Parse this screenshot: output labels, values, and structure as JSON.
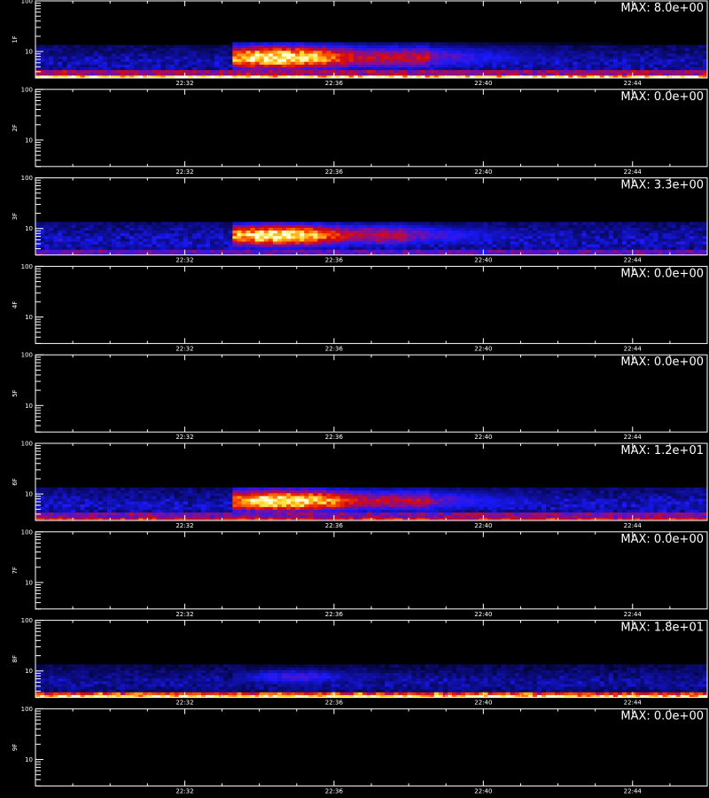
{
  "chart_data": [
    {
      "type": "heatmap",
      "ylabel": "1F",
      "max_label": "MAX: 8.0e+00",
      "max": 8.0,
      "yscale": "log",
      "ylim": [
        3,
        100
      ],
      "yticklabels": [
        "100",
        "10"
      ],
      "xticklabels": [
        "22:32",
        "22:36",
        "22:40",
        "22:44"
      ],
      "xlim": [
        "22:28",
        "22:46"
      ],
      "signal": {
        "start": "22:33:20",
        "peak": "22:34:30",
        "end": "22:38:30",
        "emin": 5,
        "emax": 12,
        "tail_end": "22:46",
        "floor_band": {
          "emin": 3,
          "emax": 3.6,
          "level": 0.95
        },
        "blue_band": {
          "emin": 3.6,
          "emax": 4.4,
          "level": 0.5
        },
        "background": 0.1
      }
    },
    {
      "type": "heatmap",
      "ylabel": "2F",
      "max_label": "MAX: 0.0e+00",
      "max": 0.0,
      "yscale": "log",
      "ylim": [
        3,
        100
      ],
      "yticklabels": [
        "100",
        "10"
      ],
      "xticklabels": [
        "22:32",
        "22:36",
        "22:40",
        "22:44"
      ],
      "xlim": [
        "22:28",
        "22:46"
      ],
      "signal": null
    },
    {
      "type": "heatmap",
      "ylabel": "3F",
      "max_label": "MAX: 3.3e+00",
      "max": 3.3,
      "yscale": "log",
      "ylim": [
        3,
        100
      ],
      "yticklabels": [
        "100",
        "10"
      ],
      "xticklabels": [
        "22:32",
        "22:36",
        "22:40",
        "22:44"
      ],
      "xlim": [
        "22:28",
        "22:46"
      ],
      "signal": {
        "start": "22:33:20",
        "peak": "22:34:30",
        "end": "22:38:00",
        "emin": 5,
        "emax": 11,
        "tail_end": "22:46",
        "floor_band": null,
        "blue_band": {
          "emin": 3,
          "emax": 3.8,
          "level": 0.4
        },
        "background": 0.12
      }
    },
    {
      "type": "heatmap",
      "ylabel": "4F",
      "max_label": "MAX: 0.0e+00",
      "max": 0.0,
      "yscale": "log",
      "ylim": [
        3,
        100
      ],
      "yticklabels": [
        "100",
        "10"
      ],
      "xticklabels": [
        "22:32",
        "22:36",
        "22:40",
        "22:44"
      ],
      "xlim": [
        "22:28",
        "22:46"
      ],
      "signal": null
    },
    {
      "type": "heatmap",
      "ylabel": "5F",
      "max_label": "MAX: 0.0e+00",
      "max": 0.0,
      "yscale": "log",
      "ylim": [
        3,
        100
      ],
      "yticklabels": [
        "100",
        "10"
      ],
      "xticklabels": [
        "22:32",
        "22:36",
        "22:40",
        "22:44"
      ],
      "xlim": [
        "22:28",
        "22:46"
      ],
      "signal": null
    },
    {
      "type": "heatmap",
      "ylabel": "6F",
      "max_label": "MAX: 1.2e+01",
      "max": 12.0,
      "yscale": "log",
      "ylim": [
        3,
        100
      ],
      "yticklabels": [
        "100",
        "10"
      ],
      "xticklabels": [
        "22:32",
        "22:36",
        "22:40",
        "22:44"
      ],
      "xlim": [
        "22:28",
        "22:46"
      ],
      "signal": {
        "start": "22:33:20",
        "peak": "22:34:40",
        "end": "22:38:30",
        "emin": 5,
        "emax": 11,
        "tail_end": "22:46",
        "floor_band": {
          "emin": 3,
          "emax": 3.5,
          "level": 0.62
        },
        "blue_band": {
          "emin": 3.5,
          "emax": 4.3,
          "level": 0.45
        },
        "background": 0.12
      }
    },
    {
      "type": "heatmap",
      "ylabel": "7F",
      "max_label": "MAX: 0.0e+00",
      "max": 0.0,
      "yscale": "log",
      "ylim": [
        3,
        100
      ],
      "yticklabels": [
        "100",
        "10"
      ],
      "xticklabels": [
        "22:32",
        "22:36",
        "22:40",
        "22:44"
      ],
      "xlim": [
        "22:28",
        "22:46"
      ],
      "signal": null
    },
    {
      "type": "heatmap",
      "ylabel": "8F",
      "max_label": "MAX: 1.8e+01",
      "max": 18.0,
      "yscale": "log",
      "ylim": [
        3,
        100
      ],
      "yticklabels": [
        "100",
        "10"
      ],
      "xticklabels": [
        "22:32",
        "22:36",
        "22:40",
        "22:44"
      ],
      "xlim": [
        "22:28",
        "22:46"
      ],
      "signal": {
        "start": "22:33:20",
        "peak": "22:35:00",
        "end": "22:37:00",
        "emin": 6,
        "emax": 10,
        "tail_end": "22:40",
        "weak": true,
        "floor_band": {
          "emin": 3,
          "emax": 3.5,
          "level": 0.93
        },
        "blue_band": {
          "emin": 3.5,
          "emax": 4.1,
          "level": 0.68
        },
        "background": 0.08
      }
    },
    {
      "type": "heatmap",
      "ylabel": "9F",
      "max_label": "MAX: 0.0e+00",
      "max": 0.0,
      "yscale": "log",
      "ylim": [
        3,
        100
      ],
      "yticklabels": [
        "100",
        "10"
      ],
      "xticklabels": [
        "22:32",
        "22:36",
        "22:40",
        "22:44"
      ],
      "xlim": [
        "22:28",
        "22:46"
      ],
      "signal": null
    }
  ]
}
